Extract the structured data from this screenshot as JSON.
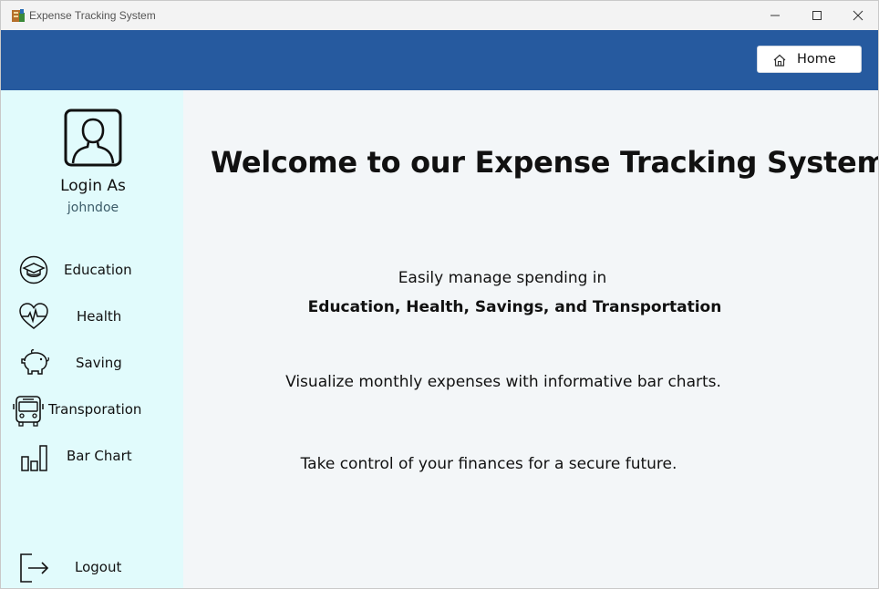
{
  "window": {
    "title": "Expense Tracking System",
    "app_icon": "ledger-app-icon",
    "controls": [
      "minimize-icon",
      "maximize-icon",
      "close-icon"
    ]
  },
  "header": {
    "color": "#265a9f",
    "home_label": "Home",
    "home_icon": "house-icon"
  },
  "sidebar": {
    "background": "#e1fbfc",
    "login_label": "Login As",
    "username": "johndoe",
    "avatar_icon": "user-avatar-icon",
    "items": [
      {
        "label": "Education",
        "icon": "graduation-cap-icon"
      },
      {
        "label": "Health",
        "icon": "heartbeat-icon"
      },
      {
        "label": "Saving",
        "icon": "piggy-bank-icon"
      },
      {
        "label": "Transporation",
        "icon": "bus-icon"
      },
      {
        "label": "Bar Chart",
        "icon": "bar-chart-icon"
      }
    ],
    "logout_label": "Logout",
    "logout_icon": "logout-icon"
  },
  "main": {
    "welcome": "Welcome to our Expense Tracking System!",
    "line1": "Easily manage spending in",
    "line2": "Education, Health, Savings, and Transportation",
    "line3": "Visualize monthly expenses with informative bar charts.",
    "line4": "Take control of your finances for a secure future."
  }
}
